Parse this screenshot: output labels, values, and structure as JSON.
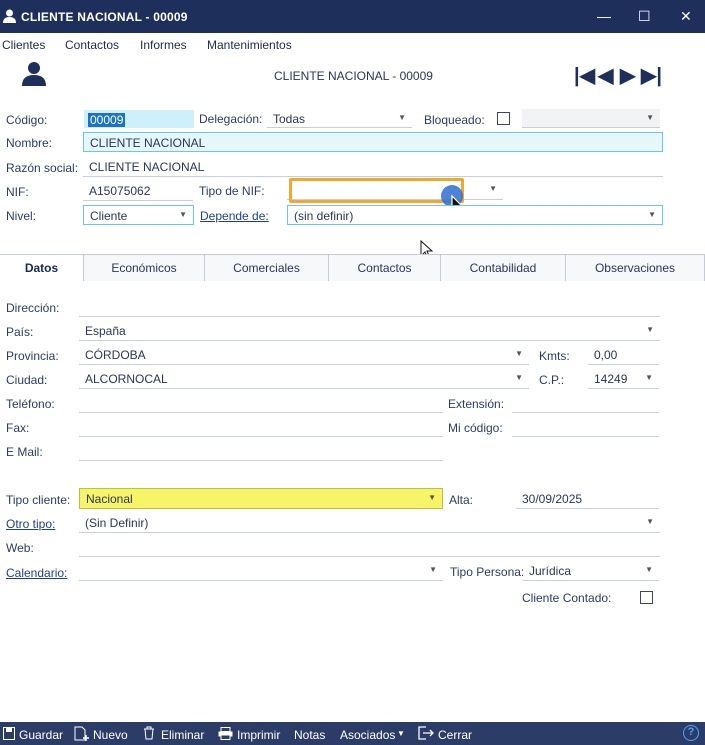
{
  "window": {
    "title": "CLIENTE NACIONAL - 00009",
    "min": "—",
    "max": "☐",
    "close": "✕"
  },
  "menu": [
    "Clientes",
    "Contactos",
    "Informes",
    "Mantenimientos"
  ],
  "header": {
    "caption": "CLIENTE NACIONAL - 00009",
    "nav": [
      "|◀",
      "◀",
      "▶",
      "▶|"
    ]
  },
  "form": {
    "codigo_label": "Código:",
    "codigo": "00009",
    "delegacion_label": "Delegación:",
    "delegacion": "Todas",
    "bloqueado_label": "Bloqueado:",
    "nombre_label": "Nombre:",
    "nombre": "CLIENTE NACIONAL",
    "razon_label": "Razón social:",
    "razon": "CLIENTE NACIONAL",
    "nif_label": "NIF:",
    "nif": "A15075062",
    "tipo_nif_label": "Tipo de NIF:",
    "tipo_nif": "",
    "nivel_label": "Nivel:",
    "nivel": "Cliente",
    "depende_label": "Depende de:",
    "depende": "(sin definir)"
  },
  "tabs": [
    "Datos",
    "Económicos",
    "Comerciales",
    "Contactos",
    "Contabilidad",
    "Observaciones"
  ],
  "datos": {
    "direccion_label": "Dirección:",
    "direccion": "",
    "pais_label": "País:",
    "pais": "España",
    "provincia_label": "Provincia:",
    "provincia": "CÓRDOBA",
    "kmts_label": "Kmts:",
    "kmts": "0,00",
    "ciudad_label": "Ciudad:",
    "ciudad": "ALCORNOCAL",
    "cp_label": "C.P.:",
    "cp": "14249",
    "telefono_label": "Teléfono:",
    "telefono": "",
    "extension_label": "Extensión:",
    "extension": "",
    "fax_label": "Fax:",
    "fax": "",
    "micodigo_label": "Mi código:",
    "micodigo": "",
    "email_label": "E Mail:",
    "email": "",
    "tipo_cliente_label": "Tipo cliente:",
    "tipo_cliente": "Nacional",
    "alta_label": "Alta:",
    "alta": "30/09/2025",
    "otro_tipo_label": "Otro tipo:",
    "otro_tipo": "(Sin Definir)",
    "web_label": "Web:",
    "web": "",
    "calendario_label": "Calendario:",
    "calendario": "",
    "tipo_persona_label": "Tipo Persona:",
    "tipo_persona": "Jurídica",
    "cliente_contado_label": "Cliente Contado:"
  },
  "footer": {
    "guardar": "Guardar",
    "nuevo": "Nuevo",
    "eliminar": "Eliminar",
    "imprimir": "Imprimir",
    "notas": "Notas",
    "asociados": "Asociados",
    "cerrar": "Cerrar",
    "help": "?"
  },
  "colors": {
    "titlebar": "#1f2f5c",
    "highlight_yellow": "#f6f568",
    "highlight_orange": "#f0a830",
    "focus_cyan": "#6cc8e0"
  }
}
